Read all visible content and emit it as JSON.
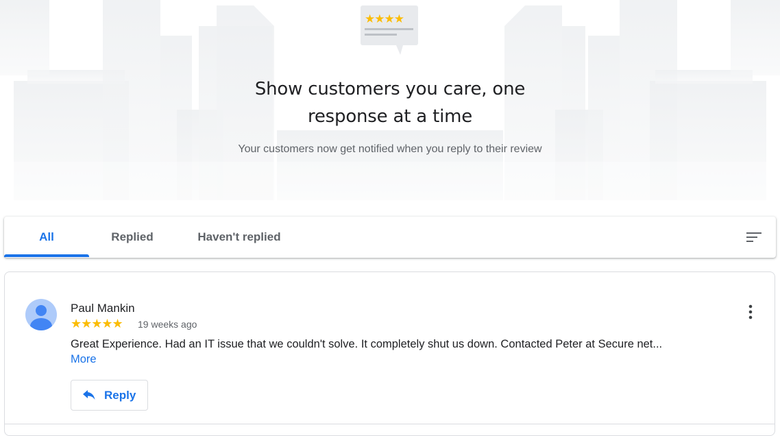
{
  "hero": {
    "title_line1": "Show customers you care, one",
    "title_line2": "response at a time",
    "subtitle": "Your customers now get notified when you reply to their review",
    "icon": "review-card-illustration"
  },
  "tabs": [
    {
      "label": "All",
      "active": true
    },
    {
      "label": "Replied",
      "active": false
    },
    {
      "label": "Haven't replied",
      "active": false
    }
  ],
  "toolbar": {
    "sort_icon": "sort-icon"
  },
  "review": {
    "reviewer_name": "Paul Mankin",
    "rating": 5,
    "stars_text": "★★★★★",
    "time_ago": "19 weeks ago",
    "text": "Great Experience. Had an IT issue that we couldn't solve. It completely shut us down. Contacted Peter at Secure net...",
    "more_label": "More",
    "reply_label": "Reply",
    "menu_icon": "more-vert-icon",
    "reply_icon": "reply-arrow-icon"
  },
  "colors": {
    "accent": "#1a73e8",
    "star": "#fbbc04",
    "text_primary": "#202124",
    "text_secondary": "#5f6368",
    "avatar_bg": "#aecbfa",
    "avatar_fg": "#4285f4"
  }
}
